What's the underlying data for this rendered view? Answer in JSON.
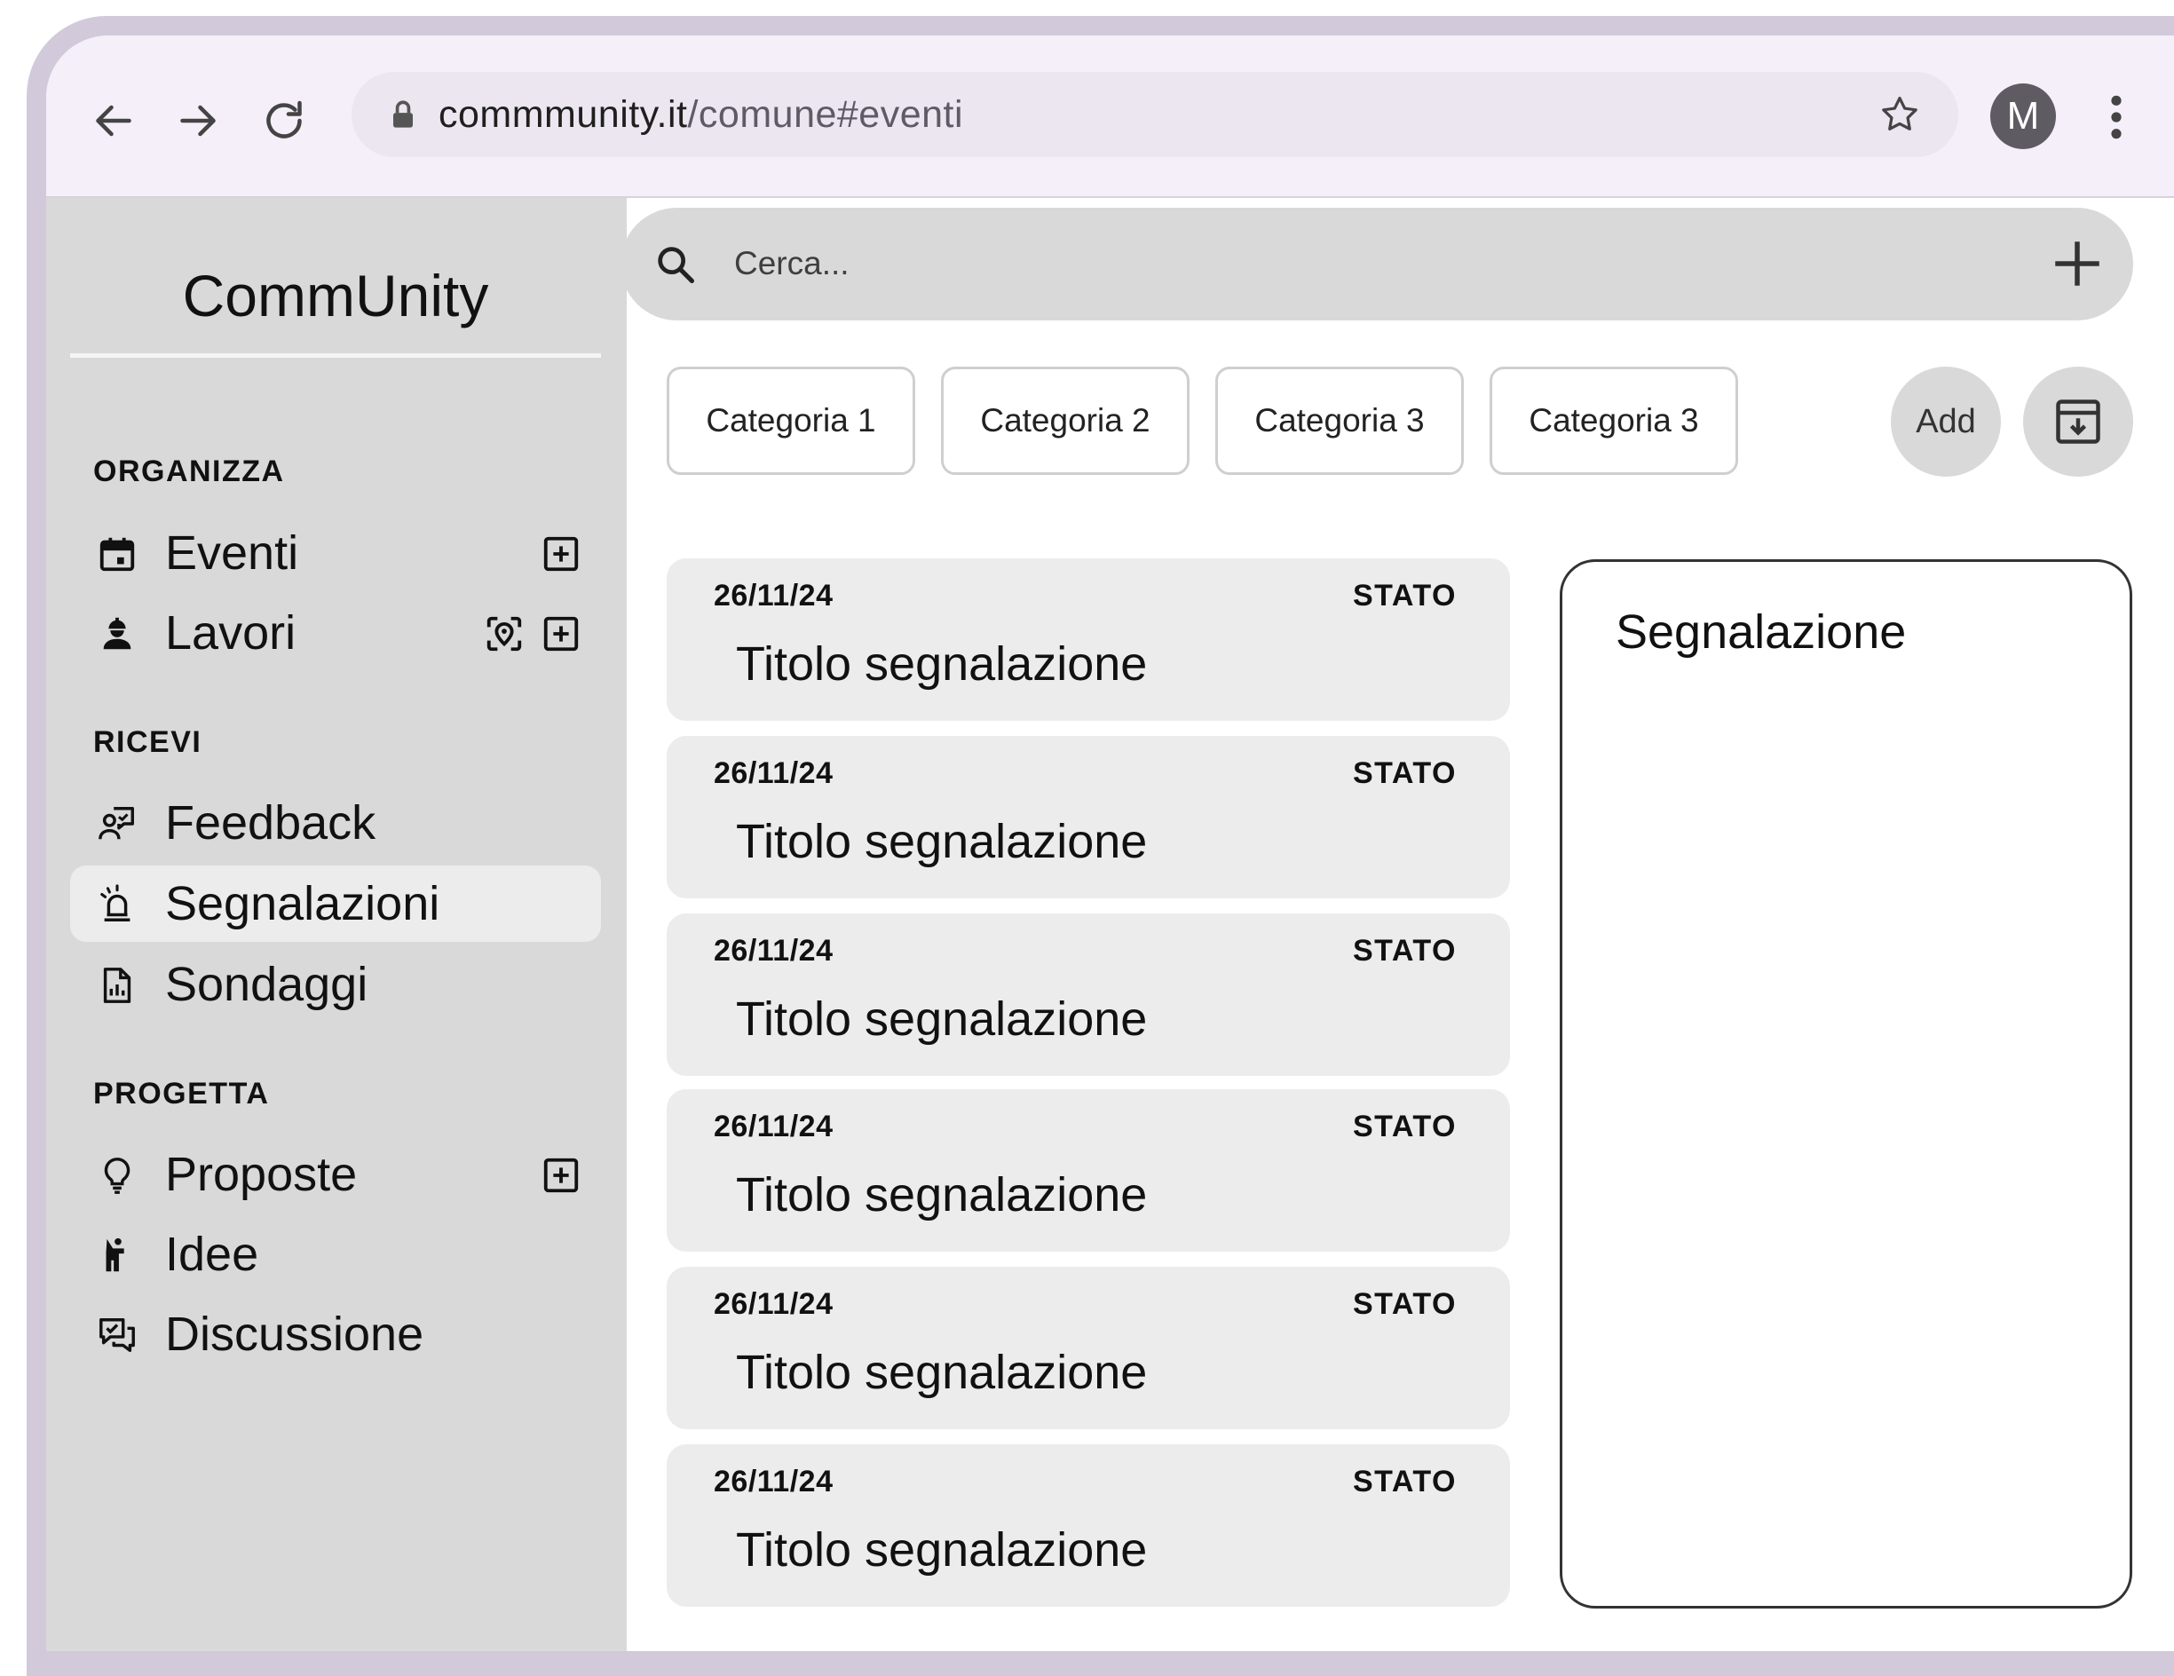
{
  "browser": {
    "url_host": "commmunity.it",
    "url_path": "/comune#eventi",
    "avatar_letter": "M"
  },
  "sidebar": {
    "brand": "CommUnity",
    "sections": [
      {
        "title": "ORGANIZZA"
      },
      {
        "title": "RICEVI"
      },
      {
        "title": "PROGETTA"
      }
    ],
    "items": [
      {
        "label": "Eventi"
      },
      {
        "label": "Lavori"
      },
      {
        "label": "Feedback"
      },
      {
        "label": "Segnalazioni"
      },
      {
        "label": "Sondaggi"
      },
      {
        "label": "Proposte"
      },
      {
        "label": "Idee"
      },
      {
        "label": "Discussione"
      }
    ]
  },
  "search": {
    "placeholder": "Cerca..."
  },
  "filters": {
    "chips": [
      "Categoria 1",
      "Categoria 2",
      "Categoria 3",
      "Categoria 3"
    ],
    "add_label": "Add"
  },
  "reports": [
    {
      "date": "26/11/24",
      "status": "STATO",
      "title": "Titolo segnalazione"
    },
    {
      "date": "26/11/24",
      "status": "STATO",
      "title": "Titolo segnalazione"
    },
    {
      "date": "26/11/24",
      "status": "STATO",
      "title": "Titolo segnalazione"
    },
    {
      "date": "26/11/24",
      "status": "STATO",
      "title": "Titolo segnalazione"
    },
    {
      "date": "26/11/24",
      "status": "STATO",
      "title": "Titolo segnalazione"
    },
    {
      "date": "26/11/24",
      "status": "STATO",
      "title": "Titolo segnalazione"
    }
  ],
  "detail": {
    "title": "Segnalazione"
  },
  "colors": {
    "frame": "#d2c9da",
    "topbar": "#f4eff8",
    "sidebar": "#d9d9d9",
    "card": "#ececec"
  }
}
